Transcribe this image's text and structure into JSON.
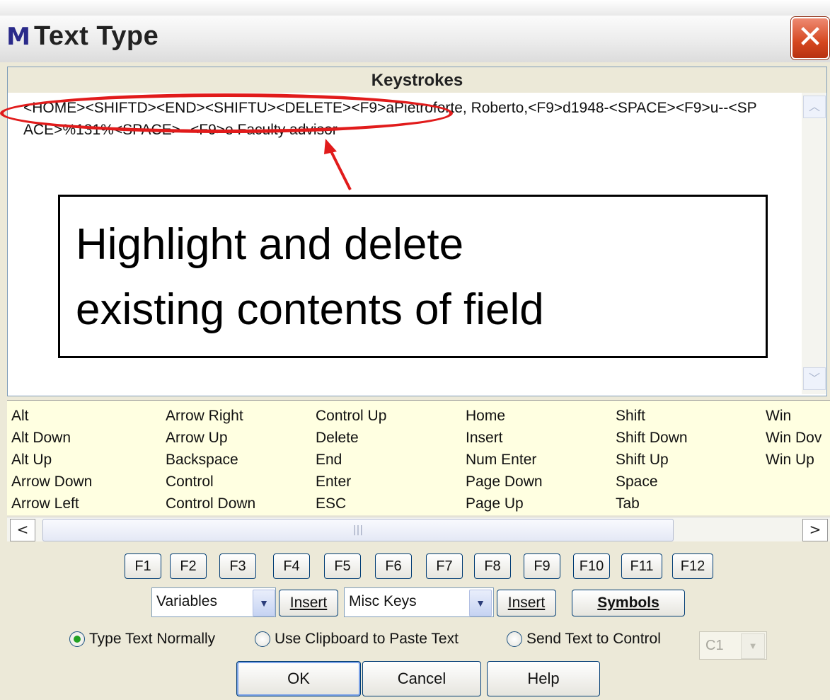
{
  "window": {
    "app_icon": "M",
    "title": "Text Type",
    "close_glyph": "✕"
  },
  "keystrokes": {
    "header": "Keystrokes",
    "text": "<HOME><SHIFTD><END><SHIFTU><DELETE><F9>aPietroforte, Roberto,<F9>d1948-<SPACE><F9>u--<SPACE>%131%<SPACE>--<F9>e Faculty advisor"
  },
  "callout": {
    "line1": "Highlight and delete",
    "line2": "existing contents of field"
  },
  "key_list": {
    "columns": [
      [
        "Alt",
        "Alt Down",
        "Alt Up",
        "Arrow Down",
        "Arrow Left"
      ],
      [
        "Arrow Right",
        "Arrow Up",
        "Backspace",
        "Control",
        "Control Down"
      ],
      [
        "Control Up",
        "Delete",
        "End",
        "Enter",
        "ESC"
      ],
      [
        "Home",
        "Insert",
        "Num Enter",
        "Page Down",
        "Page Up"
      ],
      [
        "Shift",
        "Shift Down",
        "Shift Up",
        "Space",
        "Tab"
      ],
      [
        "Win",
        "Win Dov",
        "Win Up"
      ]
    ],
    "scroll_left": "<",
    "scroll_right": ">",
    "thumb_grip": "|||"
  },
  "function_keys": [
    "F1",
    "F2",
    "F3",
    "F4",
    "F5",
    "F6",
    "F7",
    "F8",
    "F9",
    "F10",
    "F11",
    "F12"
  ],
  "variables": {
    "selected": "Variables",
    "insert_label": "Insert"
  },
  "misc_keys": {
    "selected": "Misc Keys",
    "insert_label": "Insert"
  },
  "symbols_label": "Symbols",
  "radios": [
    {
      "label": "Type Text Normally",
      "checked": true
    },
    {
      "label": "Use Clipboard to Paste Text",
      "checked": false
    },
    {
      "label": "Send Text to Control",
      "checked": false
    }
  ],
  "control_select": {
    "selected": "C1"
  },
  "buttons": {
    "ok": "OK",
    "cancel": "Cancel",
    "help": "Help"
  },
  "colors": {
    "annotation_red": "#e11b1b",
    "tooltip_yellow": "#ffffe1",
    "dialog_bg": "#ece9d8"
  }
}
